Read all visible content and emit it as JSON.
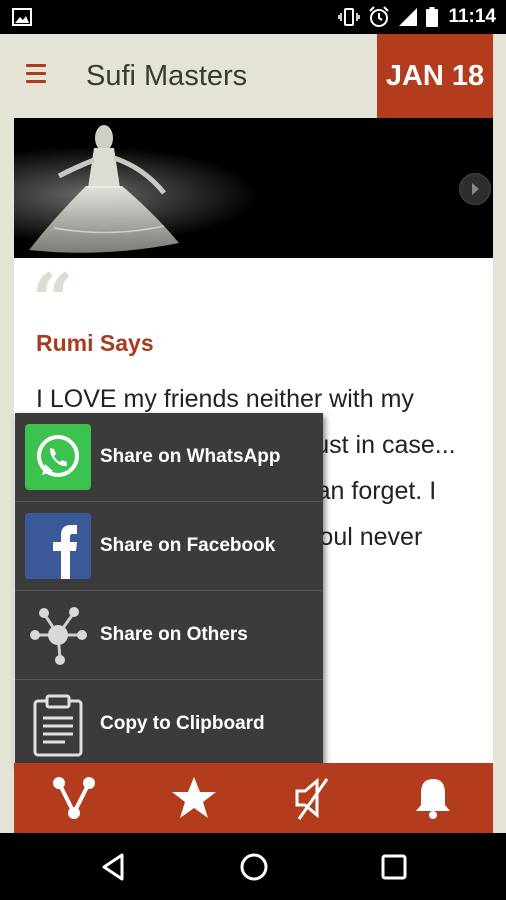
{
  "status_bar": {
    "time": "11:14",
    "icons": [
      "image-icon",
      "vibrate-icon",
      "alarm-icon",
      "signal-icon",
      "battery-icon"
    ]
  },
  "app_bar": {
    "title": "Sufi Masters",
    "date": "JAN 18",
    "menu_icon": "hamburger-menu-icon"
  },
  "banner": {
    "image": "whirling-dervish-photo",
    "next_icon": "play-next-icon"
  },
  "quote": {
    "mark": "“",
    "author": "Rumi Says",
    "text": "I LOVE my friends neither with my heart nor with my mind. Just in case... Heart might stop. MIND can forget. I love them with my soul. Soul never stops or forgets."
  },
  "share_menu": {
    "items": [
      {
        "label": "Share on WhatsApp",
        "icon": "whatsapp-icon"
      },
      {
        "label": "Share on Facebook",
        "icon": "facebook-icon"
      },
      {
        "label": "Share on Others",
        "icon": "share-network-icon"
      },
      {
        "label": "Copy to Clipboard",
        "icon": "clipboard-icon"
      }
    ]
  },
  "bottom_bar": {
    "icons": [
      "share-icon",
      "star-icon",
      "sound-off-icon",
      "bell-icon"
    ]
  },
  "nav_bar": {
    "icons": [
      "back-icon",
      "home-icon",
      "recents-icon"
    ]
  },
  "colors": {
    "accent": "#b33c1f",
    "background": "#e4e3d6",
    "menu_bg": "#3b3b3b"
  }
}
